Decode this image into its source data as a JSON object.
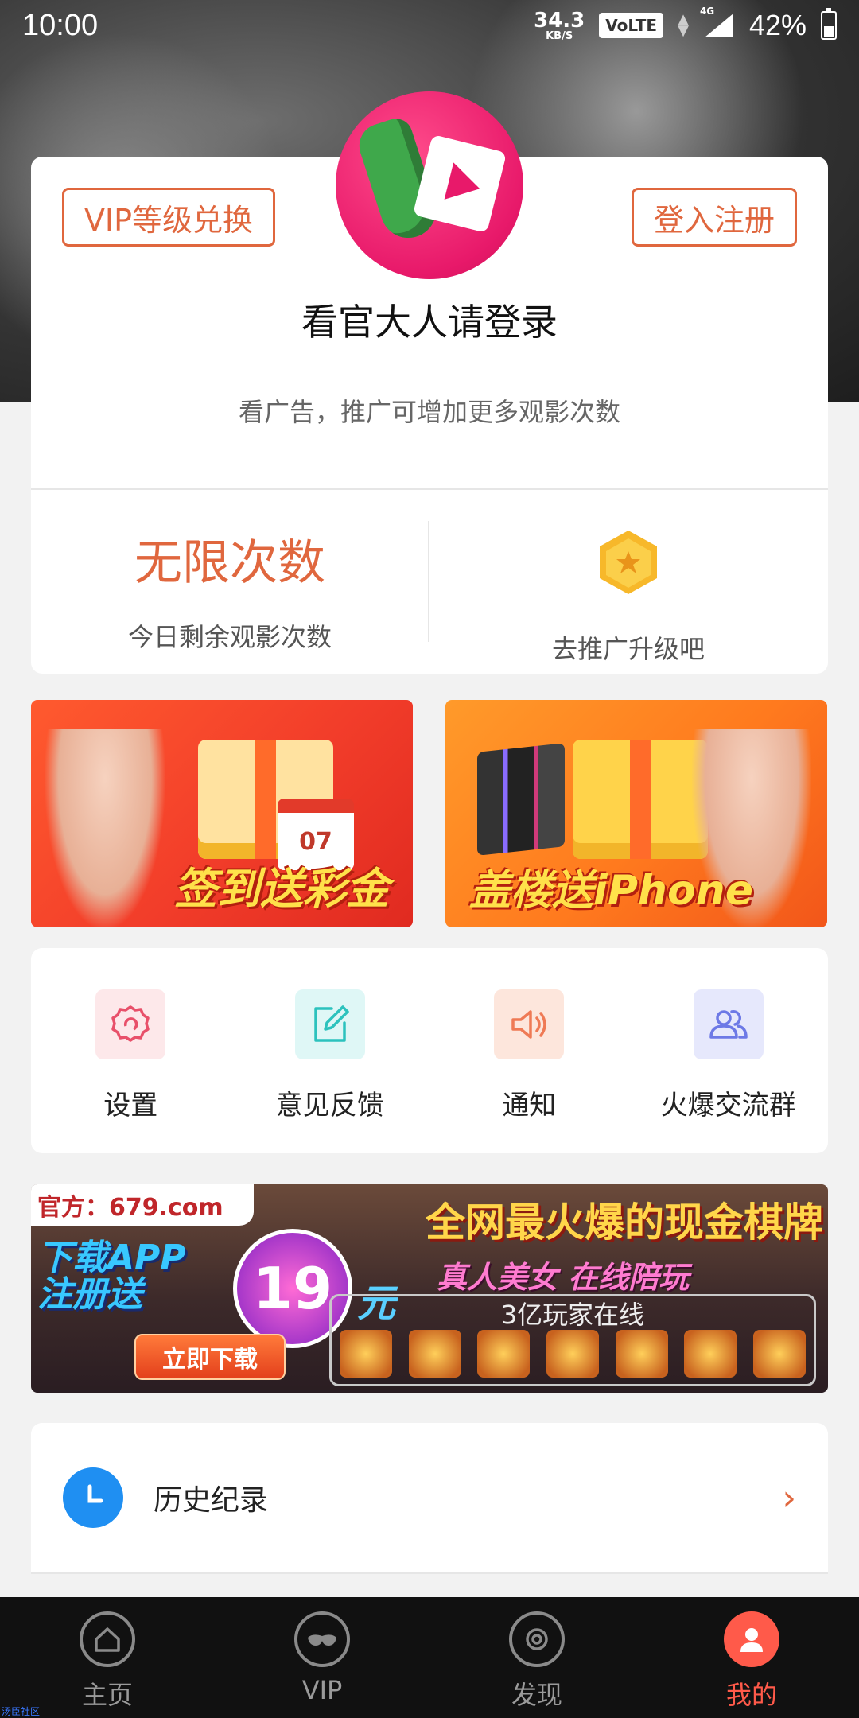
{
  "status_bar": {
    "time": "10:00",
    "net_speed_value": "34.3",
    "net_speed_unit": "KB/S",
    "volte": "VoLTE",
    "network": "4G",
    "battery_pct": "42%"
  },
  "profile": {
    "vip_exchange_label": "VIP等级兑换",
    "login_register_label": "登入注册",
    "login_title": "看官大人请登录",
    "login_subtitle": "看广告，推广可增加更多观影次数",
    "remaining_value": "无限次数",
    "remaining_label": "今日剩余观影次数",
    "upgrade_label": "去推广升级吧"
  },
  "promos": [
    {
      "text": "签到送彩金",
      "calendar": "07"
    },
    {
      "text": "盖楼送iPhone"
    }
  ],
  "actions": [
    {
      "label": "设置",
      "icon": "settings-icon",
      "bg": "#fde8ea",
      "color": "#e8506a"
    },
    {
      "label": "意见反馈",
      "icon": "feedback-edit-icon",
      "bg": "#dff7f6",
      "color": "#2cc2bd"
    },
    {
      "label": "通知",
      "icon": "speaker-icon",
      "bg": "#fde6dc",
      "color": "#ef7a55"
    },
    {
      "label": "火爆交流群",
      "icon": "group-users-icon",
      "bg": "#e6e8fc",
      "color": "#6d79e6"
    }
  ],
  "ad": {
    "domain": "官方：679.com",
    "headline": "全网最火爆的现金棋牌",
    "left_line1": "下载APP",
    "left_line2": "注册送",
    "amount": "19",
    "currency": "元",
    "tagline": "真人美女 在线陪玩",
    "players": "3亿玩家在线",
    "cta": "立即下载"
  },
  "history": {
    "label": "历史纪录"
  },
  "bottom_nav": {
    "items": [
      {
        "label": "主页",
        "icon": "home-icon"
      },
      {
        "label": "VIP",
        "icon": "mask-icon"
      },
      {
        "label": "发现",
        "icon": "discover-icon"
      },
      {
        "label": "我的",
        "icon": "profile-icon"
      }
    ],
    "watermark": "汤臣社区"
  }
}
